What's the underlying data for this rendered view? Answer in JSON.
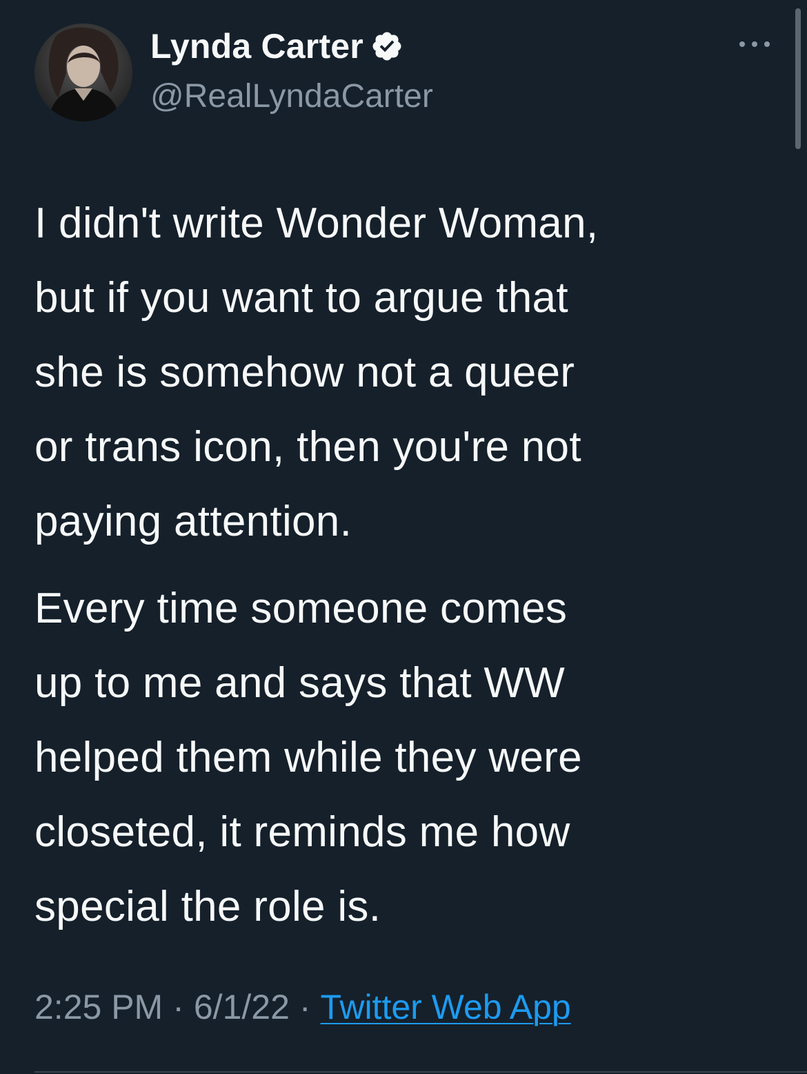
{
  "author": {
    "display_name": "Lynda Carter",
    "handle": "@RealLyndaCarter",
    "verified": true
  },
  "tweet": {
    "paragraphs": [
      "I didn't write Wonder Woman,\nbut if you want to argue that\nshe is somehow not a queer\nor trans icon, then you're not\npaying attention.",
      "Every time someone comes\nup to me and says that WW\nhelped them while they were\ncloseted, it reminds me how\nspecial the role is."
    ]
  },
  "meta": {
    "time": "2:25 PM",
    "date": "6/1/22",
    "separator": "·",
    "source": "Twitter Web App"
  },
  "icons": {
    "verified": "verified-badge-icon",
    "more": "more-dots-icon"
  },
  "colors": {
    "background": "#15202b",
    "text": "#f7f9f9",
    "secondary_text": "#8b98a5",
    "link": "#1d9bf0"
  }
}
